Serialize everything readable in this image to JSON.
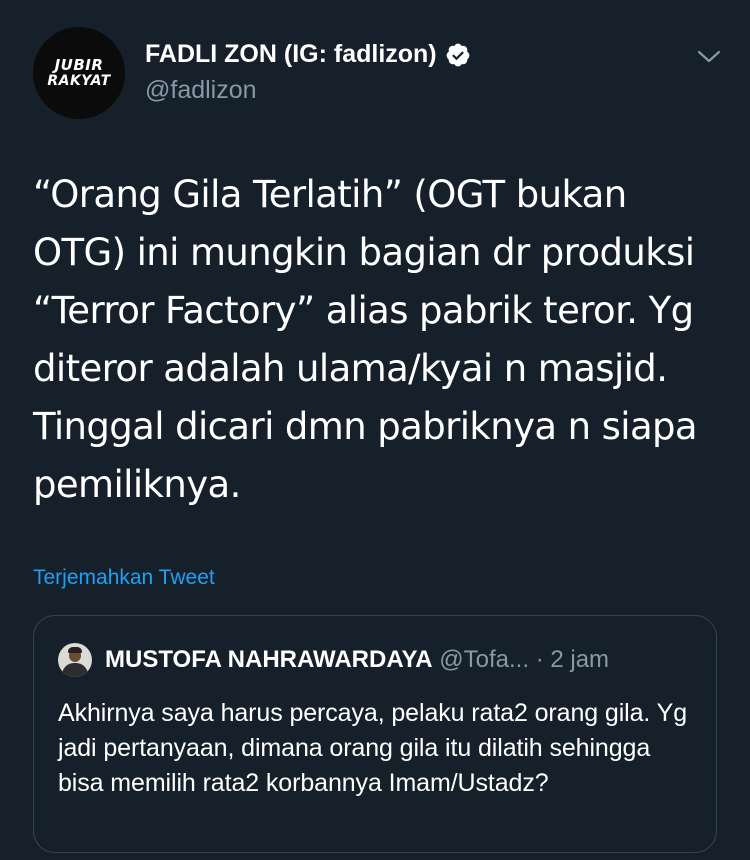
{
  "tweet": {
    "author": {
      "display_name": "FADLI ZON (IG: fadlizon)",
      "handle": "@fadlizon",
      "verified": true,
      "avatar_logo_line1": "JUBIR",
      "avatar_logo_line2": "RAKYAT"
    },
    "text": "“Orang Gila Terlatih” (OGT bukan OTG) ini mungkin bagian dr produksi “Terror Factory” alias pabrik teror. Yg diteror adalah ulama/kyai n masjid. Tinggal dicari dmn pabriknya n siapa pemiliknya.",
    "translate_label": "Terjemahkan Tweet",
    "menu_icon": "chevron-down-icon"
  },
  "quoted_tweet": {
    "display_name": "MUSTOFA NAHRAWARDAYA",
    "handle": "@Tofa...",
    "separator": "·",
    "time": "2 jam",
    "text": "Akhirnya saya harus percaya, pelaku rata2 orang gila. Yg jadi pertanyaan, dimana orang gila itu dilatih sehingga bisa memilih rata2 korbannya Imam/Ustadz?"
  },
  "colors": {
    "background": "#15202b",
    "primary_text": "#ffffff",
    "secondary_text": "#8899a6",
    "link": "#1da1f2",
    "border": "#38444d"
  }
}
